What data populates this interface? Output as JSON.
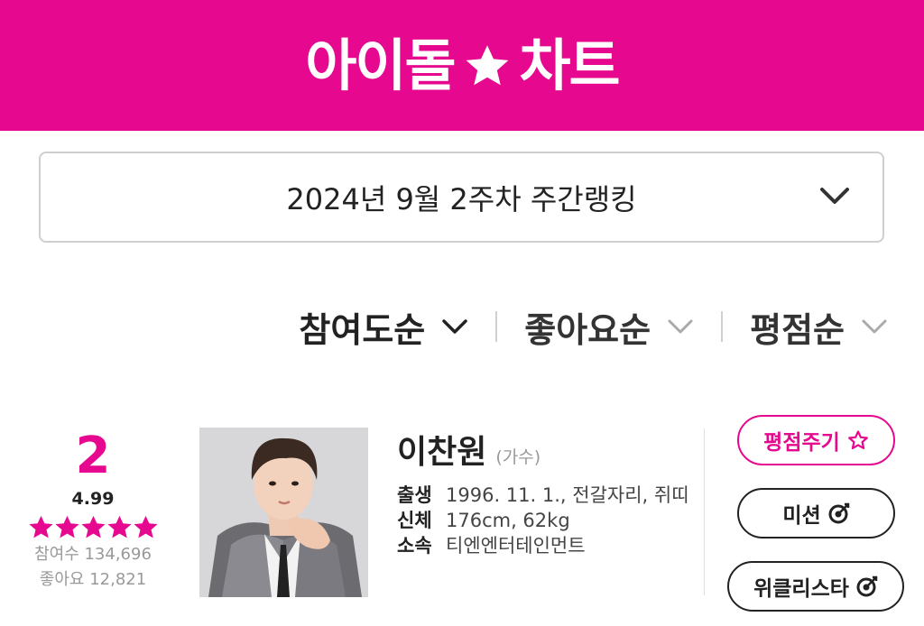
{
  "header": {
    "logo_left": "아이돌",
    "logo_right": "차트",
    "logo_star_icon": "star-icon",
    "brand_color": "#e6088f"
  },
  "week_selector": {
    "label": "2024년 9월 2주차 주간랭킹",
    "icon": "chevron-down-icon"
  },
  "sort_tabs": [
    {
      "label": "참여도순",
      "icon": "chevron-down-icon"
    },
    {
      "label": "좋아요순",
      "icon": "chevron-down-icon"
    },
    {
      "label": "평점순",
      "icon": "chevron-down-icon"
    }
  ],
  "ranking": [
    {
      "rank": "2",
      "score": "4.99",
      "star_rating": 4.99,
      "participants": "참여수 134,696",
      "likes": "좋아요 12,821",
      "name": "이찬원",
      "job": "(가수)",
      "details": [
        {
          "key": "출생",
          "value": "1996. 11. 1., 전갈자리, 쥐띠"
        },
        {
          "key": "신체",
          "value": "176cm, 62kg"
        },
        {
          "key": "소속",
          "value": "티엔엔터테인먼트"
        }
      ],
      "buttons": {
        "rate": "평점주기",
        "mission": "미션",
        "weekly_star": "위클리스타"
      }
    }
  ]
}
